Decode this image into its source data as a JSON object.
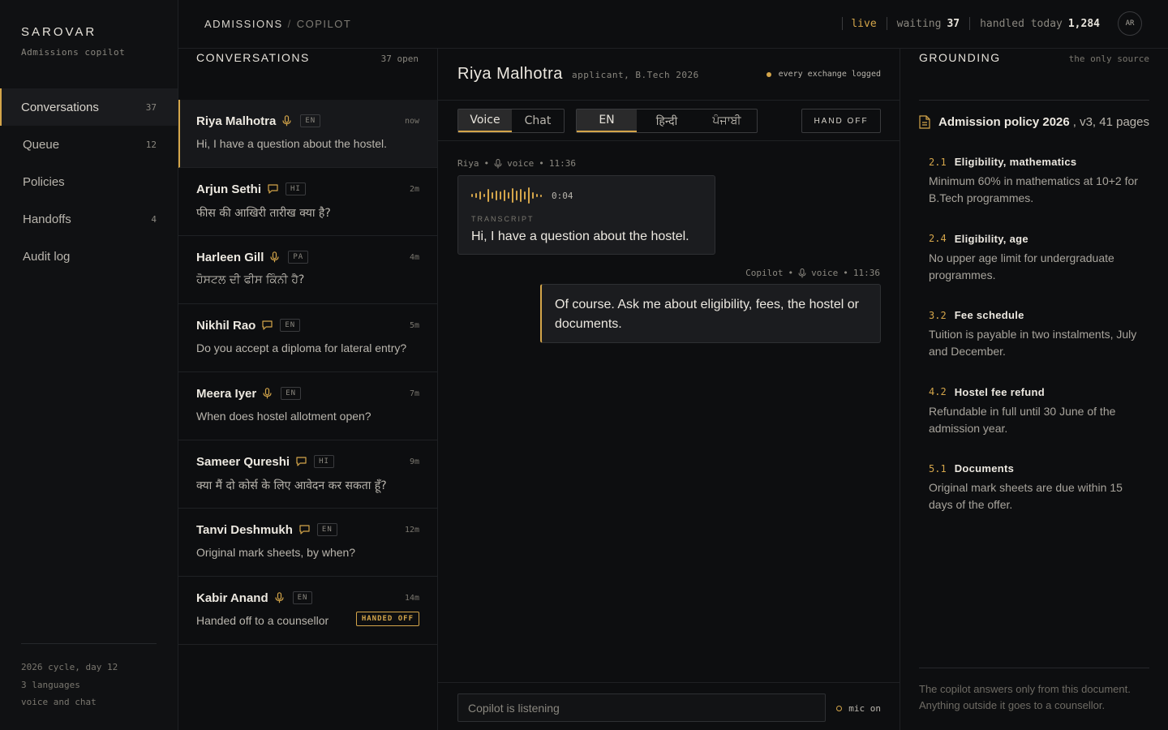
{
  "brand": {
    "name": "SAROVAR",
    "subtitle": "Admissions copilot"
  },
  "nav": [
    {
      "label": "Conversations",
      "count": "37",
      "active": true
    },
    {
      "label": "Queue",
      "count": "12"
    },
    {
      "label": "Policies",
      "count": ""
    },
    {
      "label": "Handoffs",
      "count": "4"
    },
    {
      "label": "Audit log",
      "count": ""
    }
  ],
  "sidebar_footer": [
    "2026 cycle, day 12",
    "3 languages",
    "voice and chat"
  ],
  "breadcrumb": {
    "section": "ADMISSIONS",
    "separator": "/",
    "page": "COPILOT"
  },
  "status": {
    "live": "live",
    "waiting_label": "waiting",
    "waiting_value": "37",
    "handled_label": "handled today",
    "handled_value": "1,284",
    "avatar": "AR"
  },
  "conversations": {
    "title": "CONVERSATIONS",
    "meta": "37 open",
    "items": [
      {
        "name": "Riya Malhotra",
        "channel": "voice",
        "lang": "EN",
        "time": "now",
        "preview": "Hi, I have a question about the hostel.",
        "active": true
      },
      {
        "name": "Arjun Sethi",
        "channel": "chat",
        "lang": "HI",
        "time": "2m",
        "preview": "फीस की आखिरी तारीख क्या है?"
      },
      {
        "name": "Harleen Gill",
        "channel": "voice",
        "lang": "PA",
        "time": "4m",
        "preview": "ਹੋਸਟਲ ਦੀ ਫੀਸ ਕਿੰਨੀ ਹੈ?"
      },
      {
        "name": "Nikhil Rao",
        "channel": "chat",
        "lang": "EN",
        "time": "5m",
        "preview": "Do you accept a diploma for lateral entry?"
      },
      {
        "name": "Meera Iyer",
        "channel": "voice",
        "lang": "EN",
        "time": "7m",
        "preview": "When does hostel allotment open?"
      },
      {
        "name": "Sameer Qureshi",
        "channel": "chat",
        "lang": "HI",
        "time": "9m",
        "preview": "क्या मैं दो कोर्स के लिए आवेदन कर सकता हूँ?"
      },
      {
        "name": "Tanvi Deshmukh",
        "channel": "chat",
        "lang": "EN",
        "time": "12m",
        "preview": "Original mark sheets, by when?"
      },
      {
        "name": "Kabir Anand",
        "channel": "voice",
        "lang": "EN",
        "time": "14m",
        "preview": "Handed off to a counsellor",
        "badge": "HANDED OFF"
      }
    ]
  },
  "chat": {
    "name": "Riya Malhotra",
    "subtitle": "applicant, B.Tech 2026",
    "logged": "every exchange logged",
    "mode_voice": "Voice",
    "mode_chat": "Chat",
    "lang_en": "EN",
    "lang_hi": "हिन्दी",
    "lang_pa": "ਪੰਜਾਬੀ",
    "handoff": "HAND OFF",
    "msg1": {
      "sender": "Riya",
      "channel": "voice",
      "time": "11:36",
      "duration": "0:04",
      "transcript_label": "TRANSCRIPT",
      "text": "Hi, I have a question about the hostel."
    },
    "msg2": {
      "sender": "Copilot",
      "channel": "voice",
      "time": "11:36",
      "text": "Of course. Ask me about eligibility, fees, the hostel or documents."
    },
    "composer_placeholder": "Copilot is listening",
    "mic": "mic on"
  },
  "grounding": {
    "title": "GROUNDING",
    "meta": "the only source",
    "doc_title": "Admission policy 2026",
    "doc_meta": ", v3, 41 pages",
    "clauses": [
      {
        "num": "2.1",
        "title": "Eligibility, mathematics",
        "body": "Minimum 60% in mathematics at 10+2 for B.Tech programmes."
      },
      {
        "num": "2.4",
        "title": "Eligibility, age",
        "body": "No upper age limit for undergraduate programmes."
      },
      {
        "num": "3.2",
        "title": "Fee schedule",
        "body": "Tuition is payable in two instalments, July and December."
      },
      {
        "num": "4.2",
        "title": "Hostel fee refund",
        "body": "Refundable in full until 30 June of the admission year."
      },
      {
        "num": "5.1",
        "title": "Documents",
        "body": "Original mark sheets are due within 15 days of the offer."
      }
    ],
    "footer": "The copilot answers only from this document. Anything outside it goes to a counsellor."
  },
  "colors": {
    "accent": "#d4a54a",
    "background": "#0d0e10"
  },
  "icons": {
    "voice": "mic-icon",
    "chat": "chat-bubble-icon",
    "document": "document-icon"
  }
}
